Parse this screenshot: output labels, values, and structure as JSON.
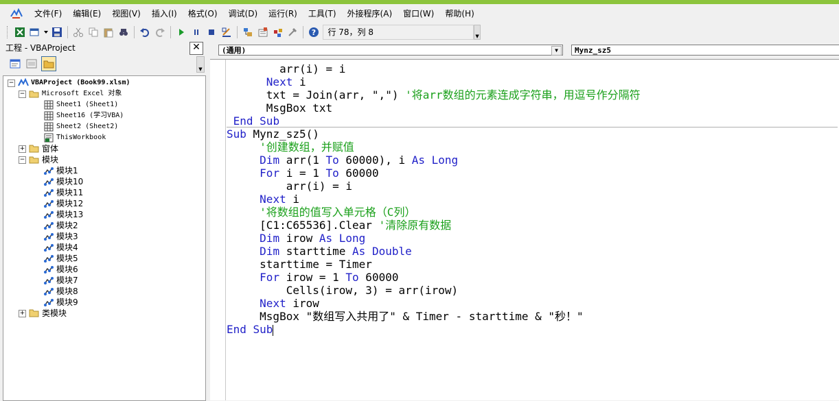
{
  "menu": [
    "文件(F)",
    "编辑(E)",
    "视图(V)",
    "插入(I)",
    "格式(O)",
    "调试(D)",
    "运行(R)",
    "工具(T)",
    "外接程序(A)",
    "窗口(W)",
    "帮助(H)"
  ],
  "status": {
    "position": "行 78，列 8"
  },
  "project": {
    "title": "工程 - VBAProject",
    "close": "✕",
    "root": "VBAProject (Book99.xlsm)",
    "excel_objects": "Microsoft Excel 对象",
    "sheets": [
      "Sheet1 (Sheet1)",
      "Sheet16 (学习VBA)",
      "Sheet2 (Sheet2)",
      "ThisWorkbook"
    ],
    "forms": "窗体",
    "modules": "模块",
    "module_items": [
      "模块1",
      "模块10",
      "模块11",
      "模块12",
      "模块13",
      "模块2",
      "模块3",
      "模块4",
      "模块5",
      "模块6",
      "模块7",
      "模块8",
      "模块9"
    ],
    "class_modules": "类模块"
  },
  "code": {
    "object_combo": "(通用)",
    "proc_combo": "Mynz_sz5"
  },
  "colors": {
    "keyword": "#1f1fc8",
    "comment": "#1aa01a",
    "accent": "#8cc43c"
  }
}
